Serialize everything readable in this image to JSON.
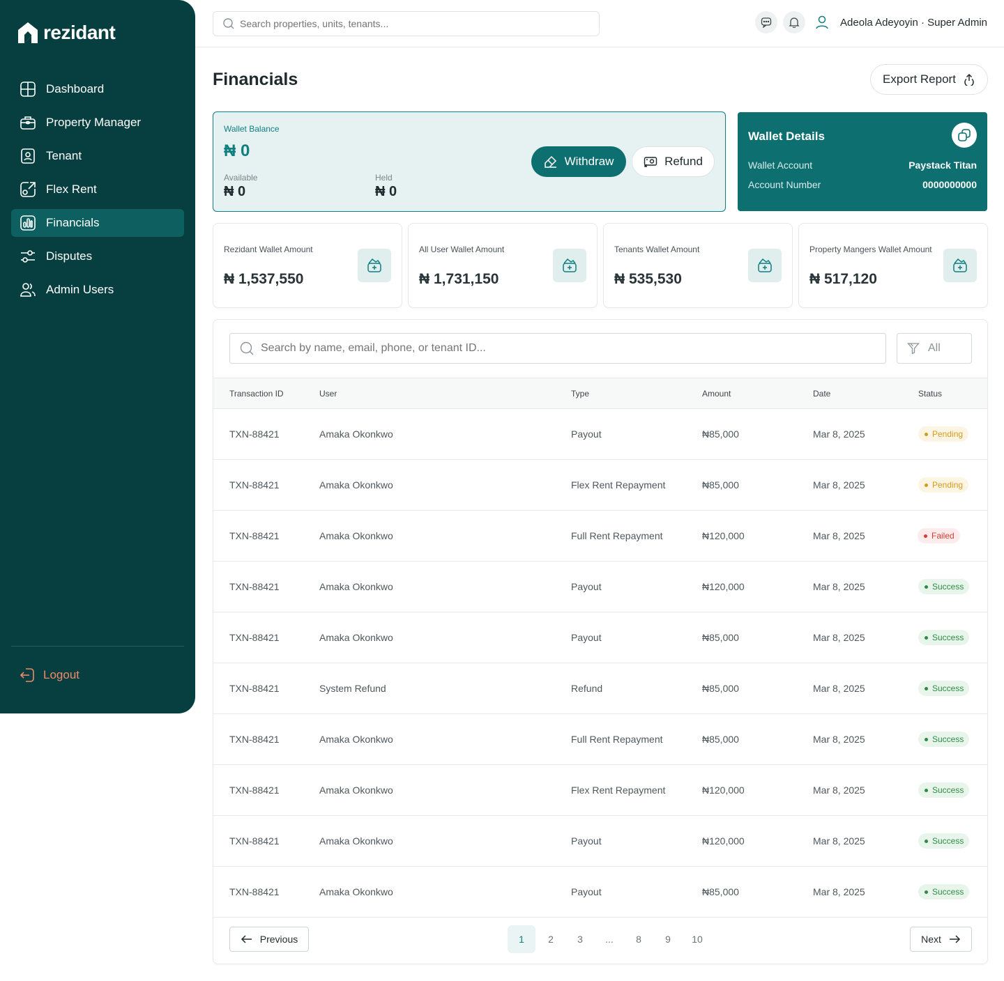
{
  "brand": {
    "name": "rezidant"
  },
  "sidebar": {
    "items": [
      {
        "label": "Dashboard",
        "icon": "dashboard-icon"
      },
      {
        "label": "Property Manager",
        "icon": "briefcase-icon"
      },
      {
        "label": "Tenant",
        "icon": "tenant-icon"
      },
      {
        "label": "Flex Rent",
        "icon": "flex-rent-icon"
      },
      {
        "label": "Financials",
        "icon": "financials-icon",
        "active": true
      },
      {
        "label": "Disputes",
        "icon": "sliders-icon"
      },
      {
        "label": "Admin Users",
        "icon": "users-icon"
      }
    ],
    "logout_label": "Logout"
  },
  "topbar": {
    "search_placeholder": "Search properties, units, tenants...",
    "user_name": "Adeola Adeyoyin · Super Admin"
  },
  "page": {
    "title": "Financials",
    "export_label": "Export Report"
  },
  "wallet": {
    "label": "Wallet Balance",
    "amount": "₦ 0",
    "available_label": "Available",
    "available_amount": "₦ 0",
    "held_label": "Held",
    "held_amount": "₦ 0",
    "withdraw_label": "Withdraw",
    "refund_label": "Refund"
  },
  "wallet_details": {
    "title": "Wallet Details",
    "account_label": "Wallet Account",
    "account_value": "Paystack Titan",
    "number_label": "Account Number",
    "number_value": "0000000000"
  },
  "stats": [
    {
      "label": "Rezidant Wallet Amount",
      "amount": "₦ 1,537,550"
    },
    {
      "label": "All User Wallet Amount",
      "amount": "₦ 1,731,150"
    },
    {
      "label": "Tenants Wallet Amount",
      "amount": "₦ 535,530"
    },
    {
      "label": "Property Mangers Wallet Amount",
      "amount": "₦ 517,120"
    }
  ],
  "table": {
    "search_placeholder": "Search by name, email, phone, or tenant ID...",
    "filter_label": "All",
    "headers": [
      "Transaction ID",
      "User",
      "Type",
      "Amount",
      "Date",
      "Status"
    ],
    "rows": [
      {
        "id": "TXN-88421",
        "user": "Amaka Okonkwo",
        "type": "Payout",
        "amount": "₦85,000",
        "date": "Mar 8, 2025",
        "status": "Pending"
      },
      {
        "id": "TXN-88421",
        "user": "Amaka Okonkwo",
        "type": "Flex Rent Repayment",
        "amount": "₦85,000",
        "date": "Mar 8, 2025",
        "status": "Pending"
      },
      {
        "id": "TXN-88421",
        "user": "Amaka Okonkwo",
        "type": "Full Rent Repayment",
        "amount": "₦120,000",
        "date": "Mar 8, 2025",
        "status": "Failed"
      },
      {
        "id": "TXN-88421",
        "user": "Amaka Okonkwo",
        "type": "Payout",
        "amount": "₦120,000",
        "date": "Mar 8, 2025",
        "status": "Success"
      },
      {
        "id": "TXN-88421",
        "user": "Amaka Okonkwo",
        "type": "Payout",
        "amount": "₦85,000",
        "date": "Mar 8, 2025",
        "status": "Success"
      },
      {
        "id": "TXN-88421",
        "user": "System Refund",
        "type": "Refund",
        "amount": "₦85,000",
        "date": "Mar 8, 2025",
        "status": "Success"
      },
      {
        "id": "TXN-88421",
        "user": "Amaka Okonkwo",
        "type": "Full Rent Repayment",
        "amount": "₦85,000",
        "date": "Mar 8, 2025",
        "status": "Success"
      },
      {
        "id": "TXN-88421",
        "user": "Amaka Okonkwo",
        "type": "Flex Rent Repayment",
        "amount": "₦120,000",
        "date": "Mar 8, 2025",
        "status": "Success"
      },
      {
        "id": "TXN-88421",
        "user": "Amaka Okonkwo",
        "type": "Payout",
        "amount": "₦120,000",
        "date": "Mar 8, 2025",
        "status": "Success"
      },
      {
        "id": "TXN-88421",
        "user": "Amaka Okonkwo",
        "type": "Payout",
        "amount": "₦85,000",
        "date": "Mar 8, 2025",
        "status": "Success"
      }
    ]
  },
  "pagination": {
    "previous_label": "Previous",
    "next_label": "Next",
    "pages": [
      "1",
      "2",
      "3",
      "...",
      "8",
      "9",
      "10"
    ],
    "current": "1"
  },
  "colors": {
    "sidebar_bg": "#073e3f",
    "accent": "#0d6f70",
    "logout": "#f08a6a",
    "pending": "#d49b1c",
    "failed": "#d93a33",
    "success": "#2e8b45"
  }
}
